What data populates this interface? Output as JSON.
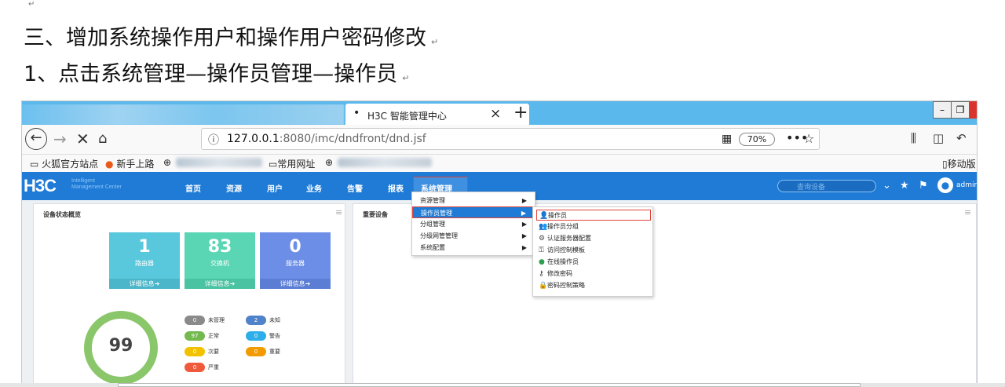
{
  "doc": {
    "mark_top": "↵",
    "heading1": "三、增加系统操作用户和操作用户密码修改",
    "heading2": "1、点击系统管理—操作员管理—操作员",
    "para_mark": "↵"
  },
  "browser": {
    "tab_active_title": "H3C 智能管理中心",
    "tab_close": "×",
    "new_tab": "+",
    "win_min": "–",
    "win_max": "❐",
    "url_host": "127.0.0.1",
    "url_rest": ":8080/imc/dndfront/dnd.jsf",
    "zoom": "70%",
    "more": "•••",
    "bookmarks": [
      "火狐官方站点",
      "新手上路",
      "常用网址",
      "移动版"
    ]
  },
  "app": {
    "logo": "H3C",
    "logo_sub1": "Intelligent",
    "logo_sub2": "Management Center",
    "menu": [
      "首页",
      "资源",
      "用户",
      "业务",
      "告警",
      "报表",
      "系统管理"
    ],
    "search_placeholder": "查询设备",
    "user": "admin",
    "colors": {
      "header": "#1f7bd6",
      "active_border": "#e0433a"
    }
  },
  "dashboard": {
    "panel1_title": "设备状态概览",
    "panel2_title": "重要设备",
    "cards": [
      {
        "value": "1",
        "label": "路由器",
        "footer": "详细信息➔",
        "color": "#5ac8dc"
      },
      {
        "value": "83",
        "label": "交换机",
        "footer": "详细信息➔",
        "color": "#5bd6b4"
      },
      {
        "value": "0",
        "label": "服务器",
        "footer": "详细信息➔",
        "color": "#6c8ee6"
      }
    ],
    "gauge_value": "99",
    "legend": [
      {
        "count": "0",
        "label": "未管理",
        "color": "#8a8a8a"
      },
      {
        "count": "2",
        "label": "未知",
        "color": "#4f82c9"
      },
      {
        "count": "97",
        "label": "正常",
        "color": "#74b94f"
      },
      {
        "count": "0",
        "label": "警告",
        "color": "#2eaee8"
      },
      {
        "count": "0",
        "label": "次要",
        "color": "#f2c200"
      },
      {
        "count": "0",
        "label": "重要",
        "color": "#f29b00"
      },
      {
        "count": "0",
        "label": "严重",
        "color": "#f05a3c"
      }
    ]
  },
  "menu_level1": [
    {
      "label": "资源管理"
    },
    {
      "label": "操作员管理"
    },
    {
      "label": "分组管理"
    },
    {
      "label": "分级网管管理"
    },
    {
      "label": "系统配置"
    }
  ],
  "menu_level2": [
    {
      "label": "操作员",
      "icon": "user-icon"
    },
    {
      "label": "操作员分组",
      "icon": "users-icon"
    },
    {
      "label": "认证服务器配置",
      "icon": "user-gear-icon"
    },
    {
      "label": "访问控制模板",
      "icon": "user-key-icon"
    },
    {
      "label": "在线操作员",
      "icon": "user-online-icon"
    },
    {
      "label": "修改密码",
      "icon": "password-icon"
    },
    {
      "label": "密码控制策略",
      "icon": "lock-icon"
    }
  ]
}
